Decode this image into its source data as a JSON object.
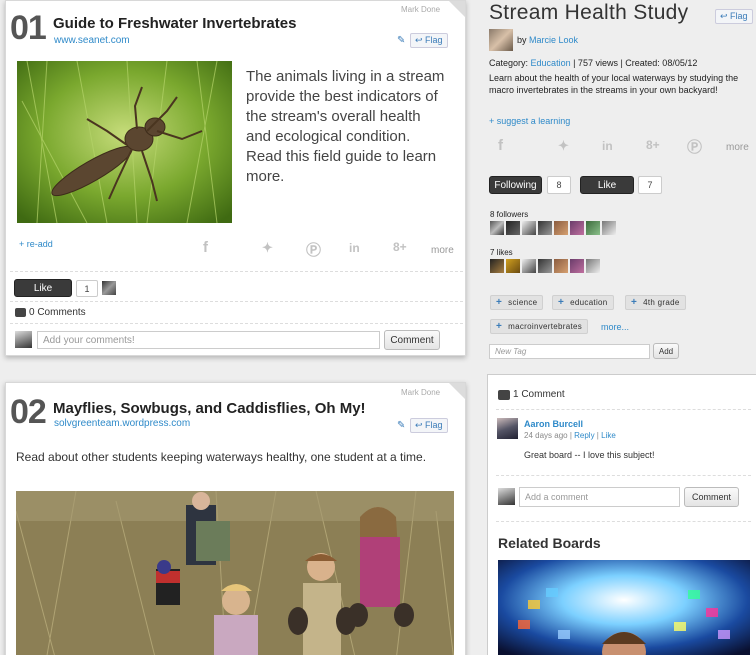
{
  "card1": {
    "number": "01",
    "title": "Guide to Freshwater Invertebrates",
    "link": "www.seanet.com",
    "mark_done": "Mark Done",
    "flag": "Flag",
    "description": "The animals living in a stream provide the best indicators of the stream's overall health and ecological condition. Read this field guide to learn more.",
    "readd": "+ re-add",
    "more": "more",
    "like_label": "Like",
    "like_count": "1",
    "comments": "0 Comments",
    "comment_placeholder": "Add your comments!",
    "comment_button": "Comment"
  },
  "card2": {
    "number": "02",
    "title": "Mayflies, Sowbugs, and Caddisflies, Oh My!",
    "link": "solvgreenteam.wordpress.com",
    "mark_done": "Mark Done",
    "flag": "Flag",
    "description": "Read about other students keeping waterways healthy, one student at a time."
  },
  "sidebar": {
    "title": "Stream Health Study",
    "flag": "Flag",
    "by_prefix": "by",
    "author": "Marcie Look",
    "category_prefix": "Category:",
    "category": "Education",
    "stats": "| 757 views | Created: 08/05/12",
    "description": "Learn about the health of your local waterways by studying the macro invertebrates in the streams in your own backyard!",
    "suggest": "+ suggest a learning",
    "more": "more",
    "following_label": "Following",
    "following_count": "8",
    "like_label": "Like",
    "like_count": "7",
    "followers_label": "8 followers",
    "likes_label": "7 likes",
    "tags": [
      "science",
      "education",
      "4th grade",
      "macroinvertebrates"
    ],
    "tags_more": "more...",
    "new_tag_placeholder": "New Tag",
    "add_button": "Add",
    "comment_count": "1 Comment",
    "comment": {
      "author": "Aaron Burcell",
      "meta": "24 days ago",
      "reply": "Reply",
      "like": "Like",
      "text": "Great board -- I love this subject!"
    },
    "add_comment_placeholder": "Add a comment",
    "comment_button": "Comment",
    "related_title": "Related Boards"
  },
  "colors": {
    "link": "#2f8ac9",
    "dark_button": "#3a3a3a",
    "background": "#eeeeee"
  }
}
